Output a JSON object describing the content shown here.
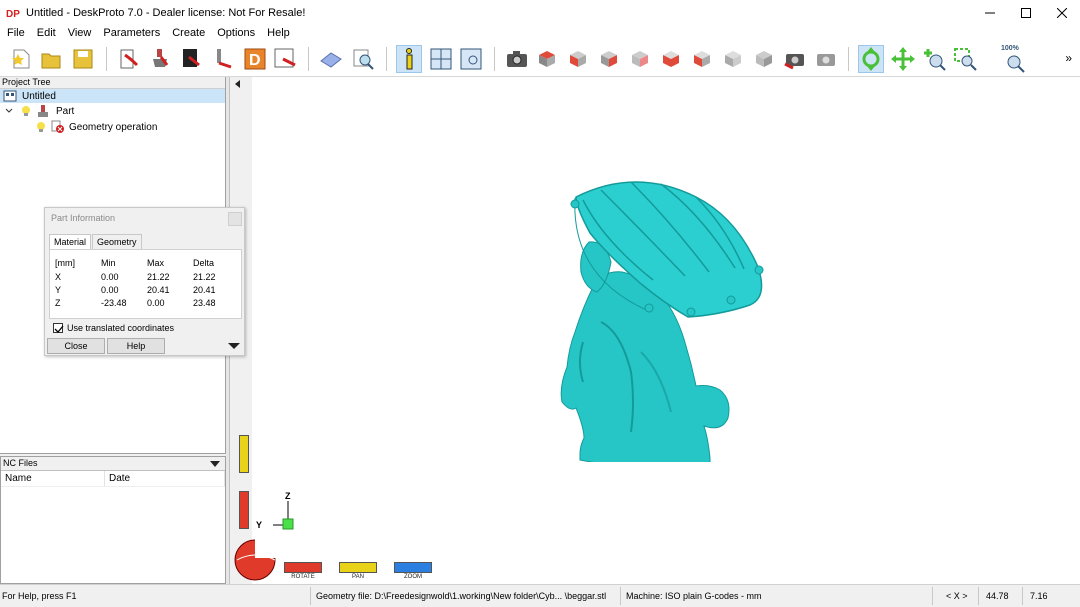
{
  "window": {
    "title": "Untitled - DeskProto 7.0 - Dealer license: Not For Resale!",
    "icon": "deskproto-logo-icon"
  },
  "menu": [
    "File",
    "Edit",
    "View",
    "Parameters",
    "Create",
    "Options",
    "Help"
  ],
  "toolbar": {
    "overflow": "»",
    "zoom_percent_label": "100%"
  },
  "project_tree": {
    "header": "Project Tree",
    "root": "Untitled",
    "part": "Part",
    "operation": "Geometry operation"
  },
  "part_info": {
    "title": "Part Information",
    "tabs": [
      "Material",
      "Geometry"
    ],
    "columns": [
      "[mm]",
      "Min",
      "Max",
      "Delta"
    ],
    "rows": [
      {
        "axis": "X",
        "min": "0.00",
        "max": "21.22",
        "delta": "21.22"
      },
      {
        "axis": "Y",
        "min": "0.00",
        "max": "20.41",
        "delta": "20.41"
      },
      {
        "axis": "Z",
        "min": "-23.48",
        "max": "0.00",
        "delta": "23.48"
      }
    ],
    "use_translated_label": "Use translated coordinates",
    "use_translated_checked": true,
    "close_label": "Close",
    "help_label": "Help"
  },
  "nc_files": {
    "header": "NC Files",
    "col_name": "Name",
    "col_date": "Date"
  },
  "view_controls": {
    "rotate": "ROTATE",
    "pan": "PAN",
    "zoom": "ZOOM",
    "axis_z": "Z",
    "axis_y": "Y"
  },
  "status": {
    "help": "For Help, press F1",
    "geometry_file": "Geometry file: D:\\Freedesignwold\\1.working\\New folder\\Cyb... \\beggar.stl",
    "machine": "Machine: ISO plain G-codes - mm",
    "coord_label": "< X >",
    "coord_x": "44.78",
    "coord_y": "7.16"
  },
  "colors": {
    "model": "#26c6c6",
    "model_shadow": "#149a9a",
    "selection": "#cce4f7",
    "rotate": "#e03a2a",
    "pan": "#e8d21a",
    "zoom": "#2a7fe0"
  }
}
